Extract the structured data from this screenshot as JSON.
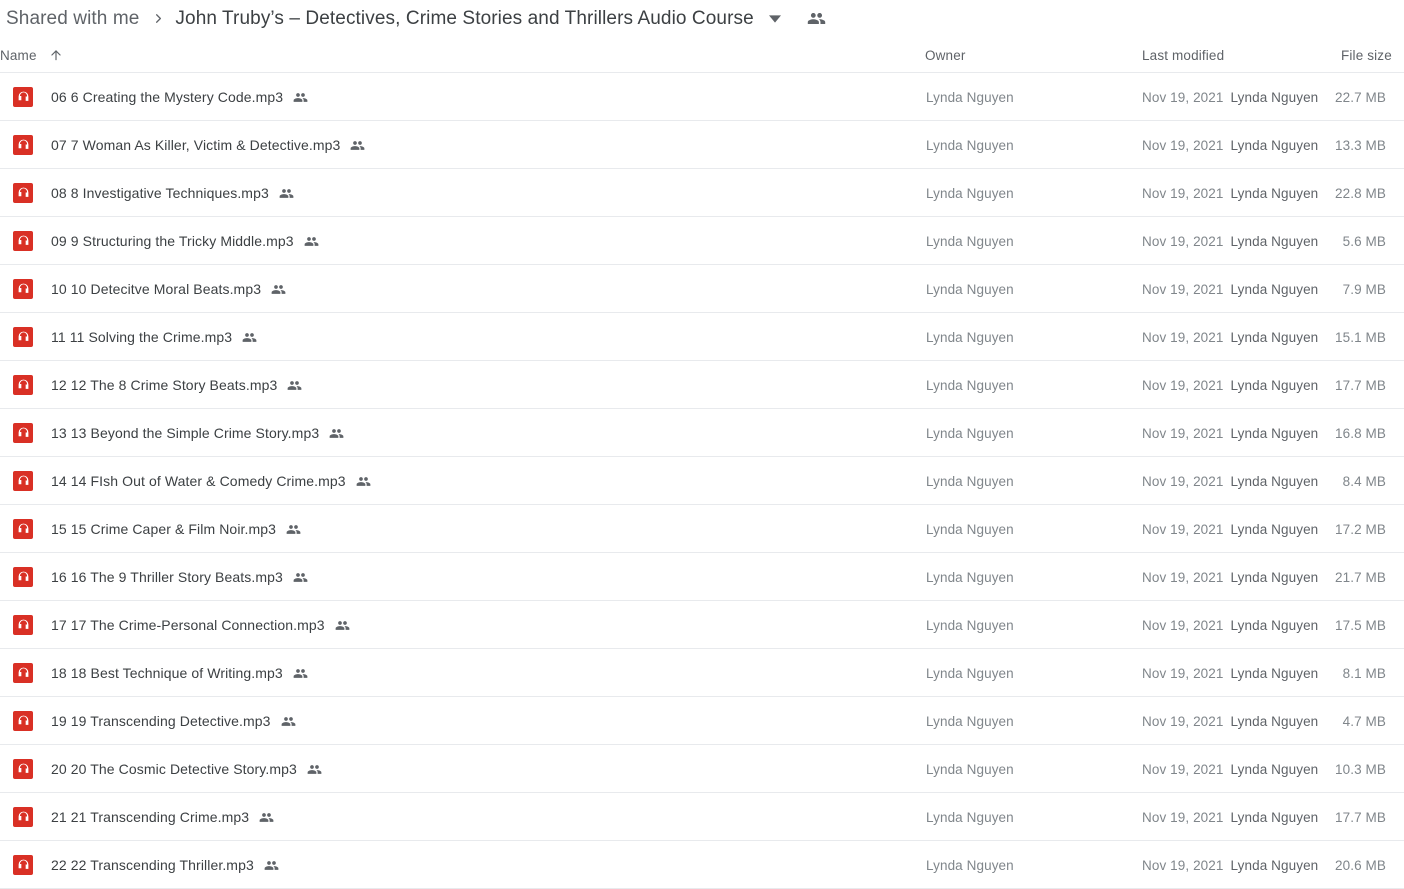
{
  "breadcrumb": {
    "root_label": "Shared with me",
    "separator_icon": "chevron-right-icon",
    "current_label": "John Truby’s – Detectives, Crime Stories and Thrillers Audio Course",
    "caret_icon": "chevron-down-icon",
    "people_icon": "people-icon"
  },
  "columns": {
    "name": "Name",
    "name_sort_icon": "arrow-up-icon",
    "owner": "Owner",
    "last_modified": "Last modified",
    "file_size": "File size"
  },
  "file_type_icon": "audio-headphone-icon",
  "shared_icon": "people-shared-icon",
  "colors": {
    "mp3_badge": "#d93025",
    "divider": "#e8eaed",
    "primary_text": "#3c4043",
    "secondary_text": "#80868b",
    "background": "#ffffff"
  },
  "files": [
    {
      "name": "06 6 Creating the Mystery Code.mp3",
      "owner": "Lynda Nguyen",
      "modified_date": "Nov 19, 2021",
      "modified_by": "Lynda Nguyen",
      "size": "22.7 MB"
    },
    {
      "name": "07 7 Woman As Killer, Victim & Detective.mp3",
      "owner": "Lynda Nguyen",
      "modified_date": "Nov 19, 2021",
      "modified_by": "Lynda Nguyen",
      "size": "13.3 MB"
    },
    {
      "name": "08 8 Investigative Techniques.mp3",
      "owner": "Lynda Nguyen",
      "modified_date": "Nov 19, 2021",
      "modified_by": "Lynda Nguyen",
      "size": "22.8 MB"
    },
    {
      "name": "09 9 Structuring the Tricky Middle.mp3",
      "owner": "Lynda Nguyen",
      "modified_date": "Nov 19, 2021",
      "modified_by": "Lynda Nguyen",
      "size": "5.6 MB"
    },
    {
      "name": "10 10 Detecitve Moral Beats.mp3",
      "owner": "Lynda Nguyen",
      "modified_date": "Nov 19, 2021",
      "modified_by": "Lynda Nguyen",
      "size": "7.9 MB"
    },
    {
      "name": "11 11 Solving the Crime.mp3",
      "owner": "Lynda Nguyen",
      "modified_date": "Nov 19, 2021",
      "modified_by": "Lynda Nguyen",
      "size": "15.1 MB"
    },
    {
      "name": "12 12 The 8 Crime Story Beats.mp3",
      "owner": "Lynda Nguyen",
      "modified_date": "Nov 19, 2021",
      "modified_by": "Lynda Nguyen",
      "size": "17.7 MB"
    },
    {
      "name": "13 13 Beyond the Simple Crime Story.mp3",
      "owner": "Lynda Nguyen",
      "modified_date": "Nov 19, 2021",
      "modified_by": "Lynda Nguyen",
      "size": "16.8 MB"
    },
    {
      "name": "14 14 FIsh Out of Water & Comedy Crime.mp3",
      "owner": "Lynda Nguyen",
      "modified_date": "Nov 19, 2021",
      "modified_by": "Lynda Nguyen",
      "size": "8.4 MB"
    },
    {
      "name": "15 15 Crime Caper & Film Noir.mp3",
      "owner": "Lynda Nguyen",
      "modified_date": "Nov 19, 2021",
      "modified_by": "Lynda Nguyen",
      "size": "17.2 MB"
    },
    {
      "name": "16 16 The 9 Thriller Story Beats.mp3",
      "owner": "Lynda Nguyen",
      "modified_date": "Nov 19, 2021",
      "modified_by": "Lynda Nguyen",
      "size": "21.7 MB"
    },
    {
      "name": "17 17 The Crime-Personal Connection.mp3",
      "owner": "Lynda Nguyen",
      "modified_date": "Nov 19, 2021",
      "modified_by": "Lynda Nguyen",
      "size": "17.5 MB"
    },
    {
      "name": "18 18 Best Technique of Writing.mp3",
      "owner": "Lynda Nguyen",
      "modified_date": "Nov 19, 2021",
      "modified_by": "Lynda Nguyen",
      "size": "8.1 MB"
    },
    {
      "name": "19 19 Transcending Detective.mp3",
      "owner": "Lynda Nguyen",
      "modified_date": "Nov 19, 2021",
      "modified_by": "Lynda Nguyen",
      "size": "4.7 MB"
    },
    {
      "name": "20 20 The Cosmic Detective Story.mp3",
      "owner": "Lynda Nguyen",
      "modified_date": "Nov 19, 2021",
      "modified_by": "Lynda Nguyen",
      "size": "10.3 MB"
    },
    {
      "name": "21 21 Transcending Crime.mp3",
      "owner": "Lynda Nguyen",
      "modified_date": "Nov 19, 2021",
      "modified_by": "Lynda Nguyen",
      "size": "17.7 MB"
    },
    {
      "name": "22 22 Transcending Thriller.mp3",
      "owner": "Lynda Nguyen",
      "modified_date": "Nov 19, 2021",
      "modified_by": "Lynda Nguyen",
      "size": "20.6 MB"
    }
  ]
}
